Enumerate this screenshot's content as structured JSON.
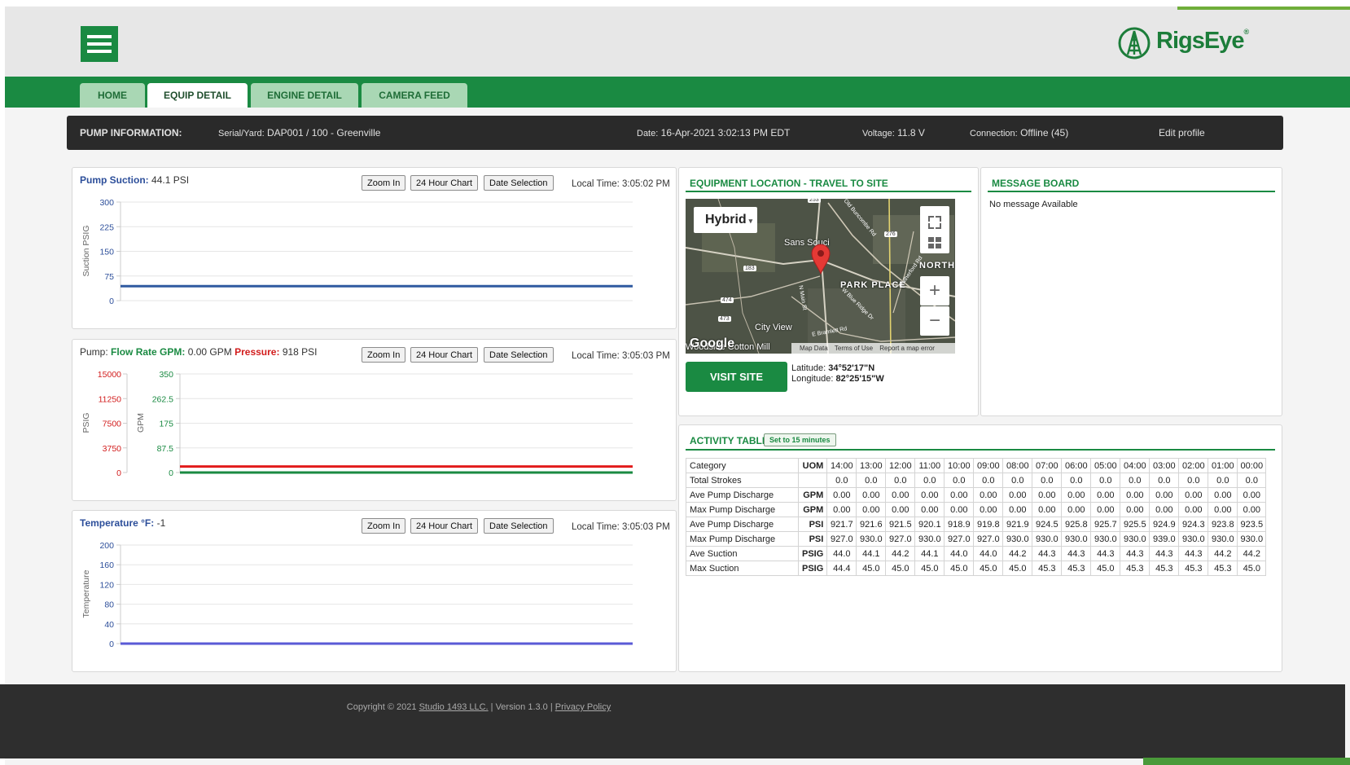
{
  "header": {
    "logo_text": "RigsEye"
  },
  "tabs": [
    {
      "label": "HOME"
    },
    {
      "label": "EQUIP DETAIL",
      "active": true
    },
    {
      "label": "ENGINE DETAIL"
    },
    {
      "label": "CAMERA FEED"
    }
  ],
  "info": {
    "label": "PUMP INFORMATION:",
    "serial_label": "Serial/Yard:",
    "serial_value": "DAP001 / 100 - Greenville",
    "date_label": "Date:",
    "date_value": "16-Apr-2021 3:02:13 PM EDT",
    "voltage_label": "Voltage:",
    "voltage_value": "11.8 V",
    "connection_label": "Connection:",
    "connection_value": "Offline (45)",
    "edit_profile": "Edit profile"
  },
  "chart_buttons": {
    "zoom_in": "Zoom In",
    "h24": "24 Hour Chart",
    "date_selection": "Date Selection"
  },
  "suction": {
    "label": "Pump Suction:",
    "value": "44.1 PSI",
    "local_time": "Local Time: 3:05:02 PM"
  },
  "flow": {
    "prefix": "Pump:",
    "rate_label": "Flow Rate GPM:",
    "rate_value": "0.00 GPM",
    "pressure_label": "Pressure:",
    "pressure_value": "918 PSI",
    "local_time": "Local Time: 3:05:03 PM"
  },
  "temperature": {
    "label": "Temperature °F:",
    "value": "-1",
    "local_time": "Local Time: 3:05:03 PM"
  },
  "chart_data": [
    {
      "type": "line",
      "ylabel": "Suction PSIG",
      "ylim": [
        0,
        300
      ],
      "yticks": [
        "300",
        "225",
        "150",
        "75",
        "0"
      ],
      "series": [
        {
          "values": [
            44.1,
            44.1
          ],
          "color": "#2f5aa0"
        }
      ]
    },
    {
      "type": "line",
      "ylabel_left": "PSIG",
      "ylabel_right": "GPM",
      "ylim_left": [
        0,
        15000
      ],
      "ylim_right": [
        0,
        350
      ],
      "yticks_left": [
        "15000",
        "11250",
        "7500",
        "3750",
        "0"
      ],
      "yticks_right": [
        "350",
        "262.5",
        "175",
        "87.5",
        "0"
      ],
      "series": [
        {
          "axis": "left",
          "values": [
            918,
            918
          ],
          "color": "#e21b1b"
        },
        {
          "axis": "right",
          "values": [
            0,
            0
          ],
          "color": "#1a8a42"
        }
      ]
    },
    {
      "type": "line",
      "ylabel": "Temperature",
      "ylim": [
        0,
        200
      ],
      "yticks": [
        "200",
        "160",
        "120",
        "80",
        "40",
        "0"
      ],
      "series": [
        {
          "values": [
            -1,
            -1
          ],
          "color": "#5a5ad6"
        }
      ]
    }
  ],
  "location": {
    "title": "EQUIPMENT LOCATION - TRAVEL TO SITE",
    "map_type": "Hybrid",
    "labels": [
      "Sans Souci",
      "PARK PLACE",
      "NORTH",
      "City View",
      "Woodside Cotton Mill",
      "Old Buncombe Rd",
      "Rutherford Rd",
      "W Blue Ridge Dr",
      "E Bramlett Rd",
      "N Main St",
      "253",
      "276",
      "183",
      "474",
      "473"
    ],
    "google": "Google",
    "map_data": "Map Data",
    "terms": "Terms of Use",
    "report": "Report a map error",
    "visit_site": "VISIT SITE",
    "latitude_label": "Latitude:",
    "latitude": "34°52'17\"N",
    "longitude_label": "Longitude:",
    "longitude": "82°25'15\"W"
  },
  "message_board": {
    "title": "MESSAGE BOARD",
    "text": "No message Available"
  },
  "activity": {
    "title": "ACTIVITY TABLE",
    "set_button": "Set to 15 minutes",
    "header": [
      "Category",
      "UOM",
      "14:00",
      "13:00",
      "12:00",
      "11:00",
      "10:00",
      "09:00",
      "08:00",
      "07:00",
      "06:00",
      "05:00",
      "04:00",
      "03:00",
      "02:00",
      "01:00",
      "00:00"
    ],
    "rows": [
      [
        "Total Strokes",
        "",
        "0.0",
        "0.0",
        "0.0",
        "0.0",
        "0.0",
        "0.0",
        "0.0",
        "0.0",
        "0.0",
        "0.0",
        "0.0",
        "0.0",
        "0.0",
        "0.0",
        "0.0"
      ],
      [
        "Ave Pump Discharge",
        "GPM",
        "0.00",
        "0.00",
        "0.00",
        "0.00",
        "0.00",
        "0.00",
        "0.00",
        "0.00",
        "0.00",
        "0.00",
        "0.00",
        "0.00",
        "0.00",
        "0.00",
        "0.00"
      ],
      [
        "Max Pump Discharge",
        "GPM",
        "0.00",
        "0.00",
        "0.00",
        "0.00",
        "0.00",
        "0.00",
        "0.00",
        "0.00",
        "0.00",
        "0.00",
        "0.00",
        "0.00",
        "0.00",
        "0.00",
        "0.00"
      ],
      [
        "Ave Pump Discharge",
        "PSI",
        "921.7",
        "921.6",
        "921.5",
        "920.1",
        "918.9",
        "919.8",
        "921.9",
        "924.5",
        "925.8",
        "925.7",
        "925.5",
        "924.9",
        "924.3",
        "923.8",
        "923.5"
      ],
      [
        "Max Pump Discharge",
        "PSI",
        "927.0",
        "930.0",
        "927.0",
        "930.0",
        "927.0",
        "927.0",
        "930.0",
        "930.0",
        "930.0",
        "930.0",
        "930.0",
        "939.0",
        "930.0",
        "930.0",
        "930.0"
      ],
      [
        "Ave Suction",
        "PSIG",
        "44.0",
        "44.1",
        "44.2",
        "44.1",
        "44.0",
        "44.0",
        "44.2",
        "44.3",
        "44.3",
        "44.3",
        "44.3",
        "44.3",
        "44.3",
        "44.2",
        "44.2"
      ],
      [
        "Max Suction",
        "PSIG",
        "44.4",
        "45.0",
        "45.0",
        "45.0",
        "45.0",
        "45.0",
        "45.0",
        "45.3",
        "45.3",
        "45.0",
        "45.3",
        "45.3",
        "45.3",
        "45.3",
        "45.0"
      ]
    ]
  },
  "footer": {
    "copyright": "Copyright © 2021",
    "company": "Studio 1493 LLC.",
    "version": " | Version 1.3.0 | ",
    "privacy": "Privacy Policy"
  }
}
